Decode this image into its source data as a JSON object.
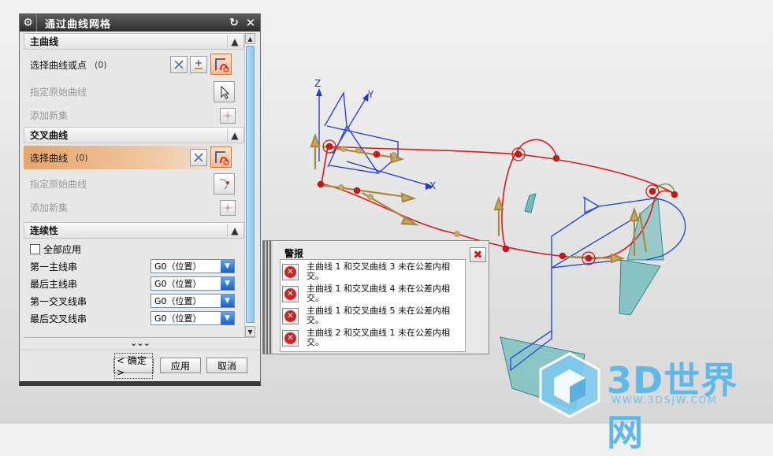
{
  "dialog": {
    "title": "通过曲线网格",
    "reset_glyph": "↻",
    "close_glyph": "✕",
    "primary_section": {
      "header": "主曲线",
      "select_label": "选择曲线或点",
      "select_count": "(0)",
      "specify_origin": "指定原始曲线",
      "add_set": "添加新集"
    },
    "cross_section": {
      "header": "交叉曲线",
      "select_label": "选择曲线",
      "select_count": "(0)",
      "specify_origin": "指定原始曲线",
      "add_set": "添加新集"
    },
    "continuity_section": {
      "header": "连续性",
      "apply_all": "全部应用",
      "rows": [
        {
          "label": "第一主线串",
          "value": "G0（位置）"
        },
        {
          "label": "最后主线串",
          "value": "G0（位置）"
        },
        {
          "label": "第一交叉线串",
          "value": "G0（位置）"
        },
        {
          "label": "最后交叉线串",
          "value": "G0（位置）"
        }
      ]
    },
    "more_glyph": "⌄⌄⌄",
    "buttons": {
      "ok": "< 确定 >",
      "apply": "应用",
      "cancel": "取消"
    }
  },
  "alert": {
    "title": "警报",
    "messages": [
      "主曲线 1 和交叉曲线 3 未在公差内相交。",
      "主曲线 1 和交叉曲线 4 未在公差内相交。",
      "主曲线 1 和交叉曲线 5 未在公差内相交。",
      "主曲线 2 和交叉曲线 1 未在公差内相交。"
    ]
  },
  "viewport": {
    "axis_labels": {
      "z": "Z",
      "y": "Y",
      "x": "X"
    },
    "colors": {
      "curve_red": "#e01818",
      "curve_blue": "#2050d8",
      "plane_teal": "#3fa9a9",
      "arrow": "#b08a3a"
    }
  },
  "watermark": {
    "name": "3D世界网",
    "url": "WWW.3DSJW.COM"
  }
}
